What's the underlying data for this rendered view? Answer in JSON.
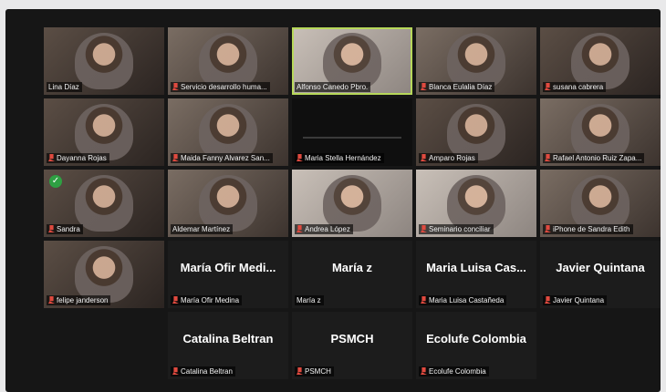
{
  "participants": [
    {
      "name": "Lina Díaz",
      "display": "video"
    },
    {
      "name": "Servicio desarrollo huma...",
      "display": "video"
    },
    {
      "name": "Alfonso Canedo Pbro.",
      "display": "video"
    },
    {
      "name": "Blanca Eulalia Díaz",
      "display": "video"
    },
    {
      "name": "susana cabrera",
      "display": "video"
    },
    {
      "name": "Dayanna Rojas",
      "display": "video"
    },
    {
      "name": "Maida Fanny Alvarez San...",
      "display": "video"
    },
    {
      "name": "Maria Stella Hernández",
      "display": "screen"
    },
    {
      "name": "Amparo Rojas",
      "display": "video"
    },
    {
      "name": "Rafael Antonio Ruiz Zapa...",
      "display": "video"
    },
    {
      "name": "Sandra",
      "display": "video"
    },
    {
      "name": "Aldemar Martínez",
      "display": "video"
    },
    {
      "name": "Andrea López",
      "display": "video"
    },
    {
      "name": "Seminario conciliar",
      "display": "video"
    },
    {
      "name": "iPhone de Sandra Edith",
      "display": "video"
    },
    {
      "name": "felipe janderson",
      "display": "video"
    },
    {
      "name": "María Ofir Medina",
      "display": "name",
      "big": "María Ofir Medi..."
    },
    {
      "name": "María z",
      "display": "name",
      "big": "María z"
    },
    {
      "name": "Maria Luisa Castañeda",
      "display": "name",
      "big": "Maria Luisa Cas..."
    },
    {
      "name": "Javier Quintana",
      "display": "name",
      "big": "Javier Quintana"
    },
    {
      "name": "Catalina Beltran",
      "display": "name",
      "big": "Catalina Beltran"
    },
    {
      "name": "PSMCH",
      "display": "name",
      "big": "PSMCH"
    },
    {
      "name": "Ecolufe Colombia",
      "display": "name",
      "big": "Ecolufe Colombia"
    }
  ],
  "accents": {
    "active_speaker_border": "#b7d85a",
    "muted_icon": "#e04a3f",
    "check_badge": "#2ea043"
  },
  "icons": {
    "mute": "microphone-muted-icon",
    "check": "check-circle-icon"
  },
  "check_symbol": "✓"
}
